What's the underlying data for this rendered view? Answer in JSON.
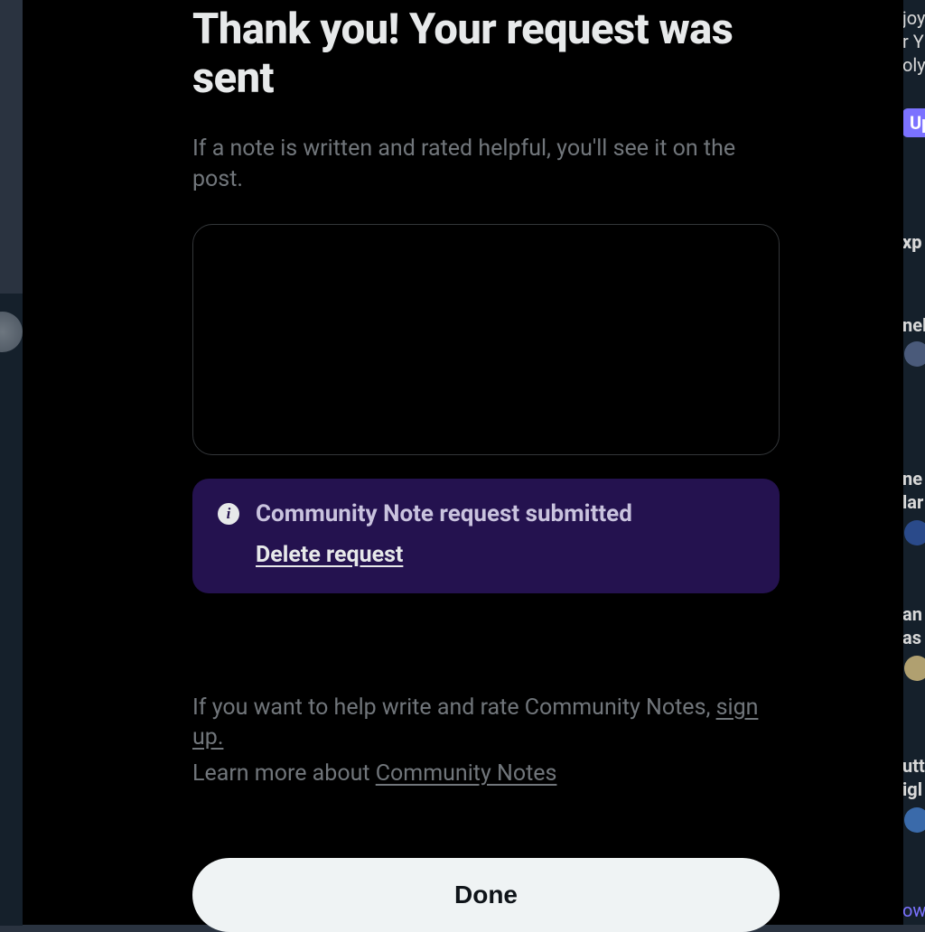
{
  "modal": {
    "title": "Thank you! Your request was sent",
    "subtitle": "If a note is written and rated helpful, you'll see it on the post.",
    "status": {
      "title": "Community Note request submitted",
      "delete_label": "Delete request"
    },
    "help": {
      "signup_pre": "If you want to help write and rate Community Notes, ",
      "signup_link": "sign up.",
      "learn_pre": "Learn more about ",
      "learn_link": "Community Notes"
    },
    "done_label": "Done"
  },
  "right_strip": {
    "t1": "joy",
    "t2": "r Y",
    "t3": "oly",
    "pill": "Up",
    "t4": "xp",
    "t5": "nel",
    "t6": "ne",
    "t7": "lar",
    "t8": "an",
    "t9": "as",
    "t10": "utt",
    "t11": "igl",
    "t12": "ow"
  }
}
